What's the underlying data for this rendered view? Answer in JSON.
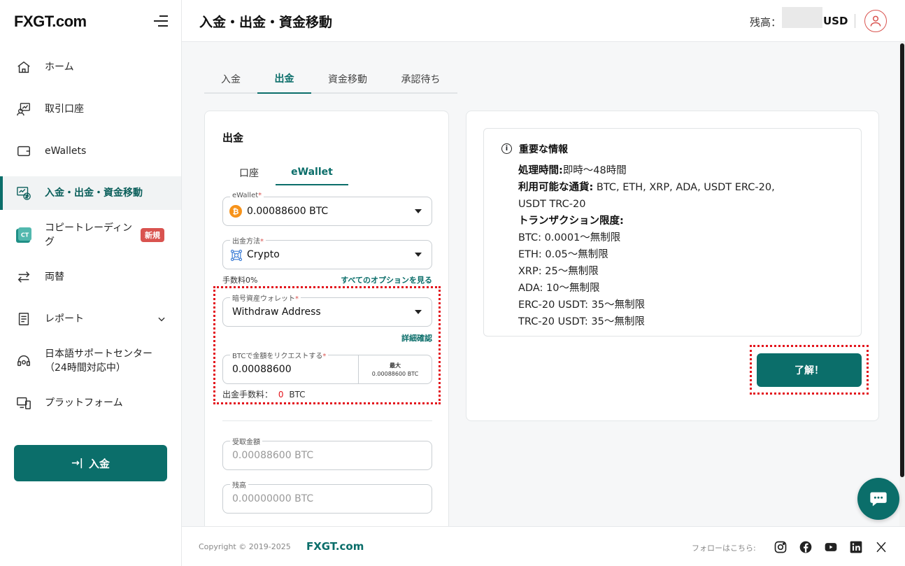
{
  "brand": {
    "logo": "FXGT.com"
  },
  "sidebar": {
    "items": [
      {
        "label": "ホーム",
        "icon": "home-icon"
      },
      {
        "label": "取引口座",
        "icon": "trading-account-icon"
      },
      {
        "label": "eWallets",
        "icon": "wallet-icon"
      },
      {
        "label": "入金・出金・資金移動",
        "icon": "funds-transfer-icon",
        "active": true
      },
      {
        "label": "コピートレーディング",
        "icon": "copy-trading-icon",
        "badge": "新規"
      },
      {
        "label": "両替",
        "icon": "exchange-icon"
      },
      {
        "label": "レポート",
        "icon": "report-icon"
      },
      {
        "label": "日本語サポートセンター（24時間対応中）",
        "icon": "support-headset-icon"
      },
      {
        "label": "プラットフォーム",
        "icon": "platform-icon"
      }
    ],
    "deposit_button": "入金"
  },
  "header": {
    "title": "入金・出金・資金移動",
    "balance_label": "残高：",
    "balance_currency": "USD"
  },
  "tabs": [
    "入金",
    "出金",
    "資金移動",
    "承認待ち"
  ],
  "withdraw": {
    "title": "出金",
    "subtabs": [
      "口座",
      "eWallet"
    ],
    "ewallet_label": "eWallet",
    "ewallet_value": "0.00088600 BTC",
    "method_label": "出金方法",
    "method_value": "Crypto",
    "fee_text": "手数料0%",
    "see_all_link": "すべてのオプションを見る",
    "crypto_wallet_label": "暗号資産ウォレット",
    "crypto_wallet_value": "Withdraw Address",
    "details_link": "詳細確認",
    "amount_label": "BTCで金額をリクエストする",
    "amount_value": "0.00088600",
    "max_label": "最大",
    "max_value": "0.00088600 BTC",
    "fee_label": "出金手数料：",
    "fee_amount": "0",
    "fee_currency": "BTC",
    "receive_label": "受取金額",
    "receive_value": "0.00088600 BTC",
    "balance_label": "残高",
    "balance_value": "0.00000000 BTC"
  },
  "info": {
    "title": "重要な情報",
    "processing_label": "処理時間:",
    "processing_value": "即時〜48時間",
    "currencies_label": "利用可能な通貨:",
    "currencies_value": " BTC, ETH, XRP, ADA, USDT ERC-20,",
    "currencies_value_2": "USDT TRC-20",
    "limits_label": "トランザクション限度:",
    "limits": [
      "BTC: 0.0001〜無制限",
      "ETH: 0.05〜無制限",
      "XRP: 25〜無制限",
      "ADA: 10〜無制限",
      "ERC-20 USDT: 35〜無制限",
      "TRC-20 USDT: 35〜無制限"
    ],
    "ok_button": "了解！"
  },
  "footer": {
    "copyright": "Copyright © 2019-2025",
    "brand": "FXGT.com",
    "follow": "フォローはこちら:",
    "social": [
      "instagram-icon",
      "facebook-icon",
      "youtube-icon",
      "linkedin-icon",
      "x-icon"
    ]
  },
  "colors": {
    "primary": "#0b6e6a",
    "highlight": "#e3141c",
    "badge": "#d9534f"
  }
}
